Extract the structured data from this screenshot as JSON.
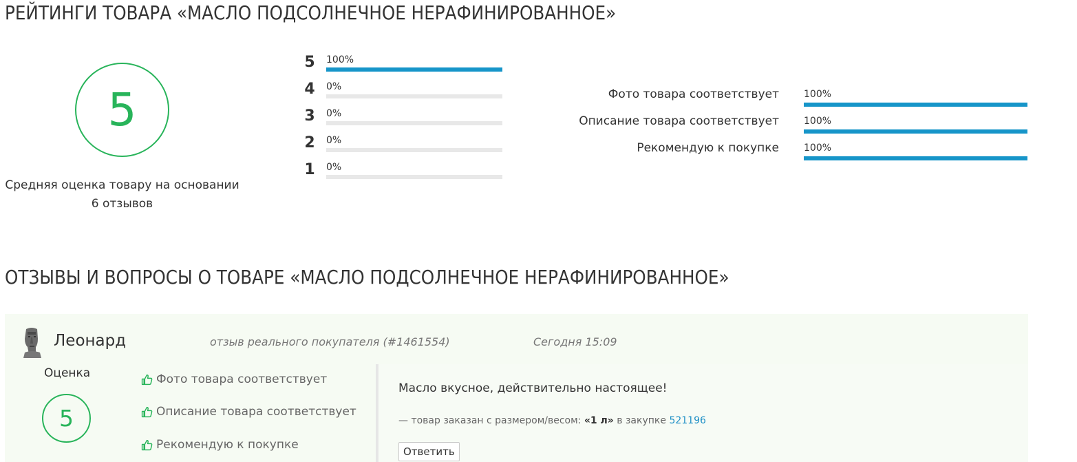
{
  "ratings": {
    "title": "РЕЙТИНГИ ТОВАРА «МАСЛО ПОДСОЛНЕЧНОЕ НЕРАФИНИРОВАННОЕ»",
    "average_score": "5",
    "average_text_line1": "Средняя оценка товару на основании",
    "average_text_line2": "6 отзывов",
    "stars": [
      {
        "stars": "5",
        "percent_label": "100%",
        "fill": 100
      },
      {
        "stars": "4",
        "percent_label": "0%",
        "fill": 0
      },
      {
        "stars": "3",
        "percent_label": "0%",
        "fill": 0
      },
      {
        "stars": "2",
        "percent_label": "0%",
        "fill": 0
      },
      {
        "stars": "1",
        "percent_label": "0%",
        "fill": 0
      }
    ],
    "criteria": [
      {
        "label": "Фото товара соответствует",
        "percent_label": "100%",
        "fill": 100
      },
      {
        "label": "Описание товара соответствует",
        "percent_label": "100%",
        "fill": 100
      },
      {
        "label": "Рекомендую к покупке",
        "percent_label": "100%",
        "fill": 100
      }
    ]
  },
  "reviews": {
    "title": "ОТЗЫВЫ И ВОПРОСЫ О ТОВАРЕ «МАСЛО ПОДСОЛНЕЧНОЕ НЕРАФИНИРОВАННОЕ»",
    "items": [
      {
        "author": "Леонард",
        "type": "отзыв реального покупателя (#1461554)",
        "date": "Сегодня 15:09",
        "score_label": "Оценка",
        "score": "5",
        "likes": [
          "Фото товара соответствует",
          "Описание товара соответствует",
          "Рекомендую к покупке"
        ],
        "text": "Масло вкусное, действительно настоящее!",
        "order_prefix": "— товар заказан с размером/весом:",
        "order_size": "«1 л»",
        "order_middle": "в закупке",
        "order_lot": "521196",
        "reply_label": "Ответить"
      }
    ]
  },
  "colors": {
    "accent_green": "#28b45a",
    "bar_blue": "#1695c9",
    "card_bg": "#f6fbf3"
  },
  "icons": [
    "avatar-moai-icon",
    "thumbs-up-icon"
  ]
}
